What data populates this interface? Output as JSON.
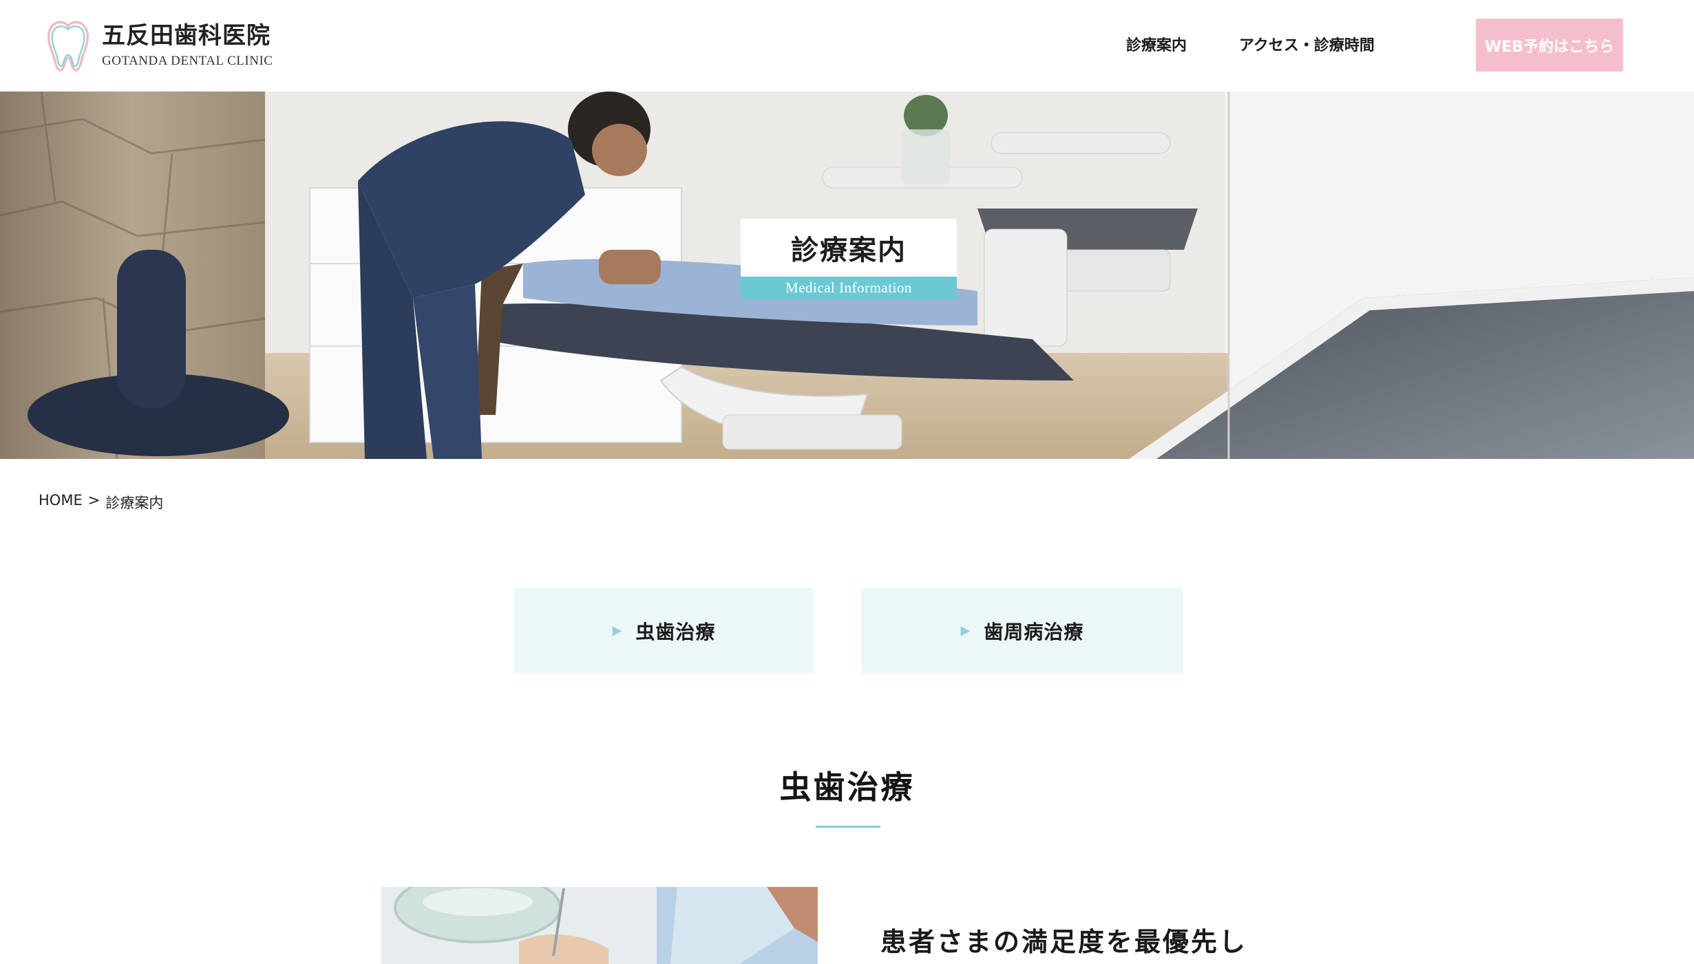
{
  "header": {
    "logo_jp": "五反田歯科医院",
    "logo_en": "GOTANDA DENTAL CLINIC",
    "nav": [
      {
        "label": "診療案内"
      },
      {
        "label": "アクセス・診療時間"
      }
    ],
    "cta_label": "WEB予約はこちら"
  },
  "hero": {
    "title": "診療案内",
    "subtitle": "Medical Information"
  },
  "breadcrumb": {
    "home": "HOME",
    "separator": ">",
    "current": "診療案内"
  },
  "tabs": [
    {
      "label": "虫歯治療"
    },
    {
      "label": "歯周病治療"
    }
  ],
  "section": {
    "title": "虫歯治療",
    "heading": "患者さまの満足度を最優先し"
  },
  "colors": {
    "accent_teal": "#6cc9d3",
    "cta_pink": "#f4bfcb",
    "tab_bg": "#ecf7f9"
  },
  "icons": {
    "tab_marker": "triangle-right-icon",
    "logo": "tooth-logo-icon"
  }
}
